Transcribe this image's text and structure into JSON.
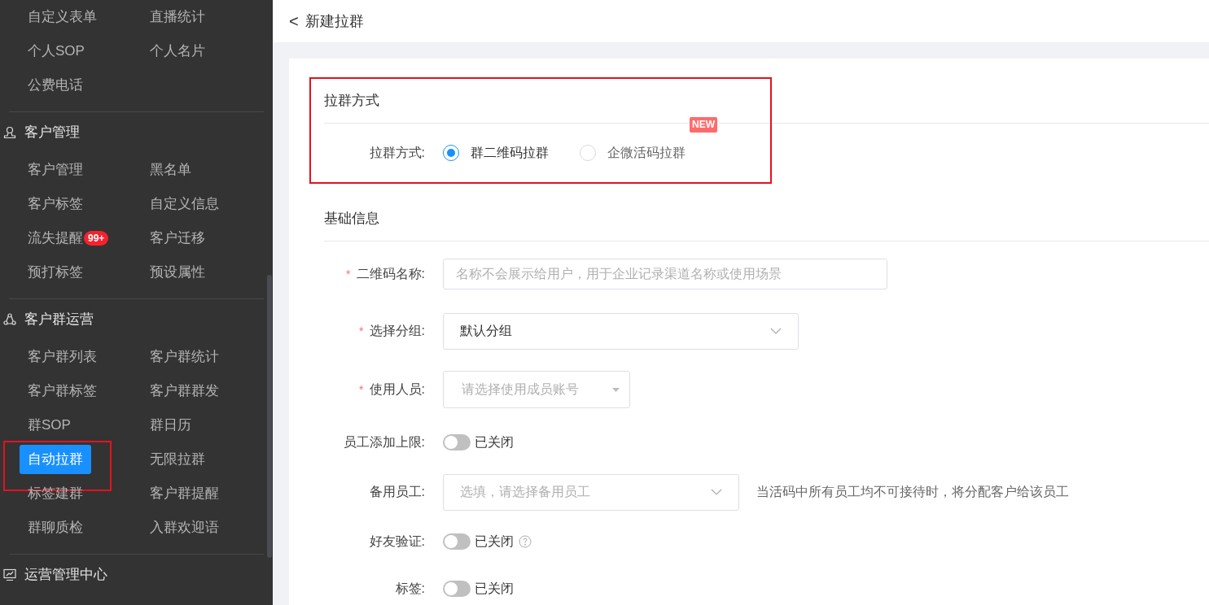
{
  "sidebar": {
    "groups": [
      {
        "items": [
          {
            "label": "自定义表单",
            "selected": false
          },
          {
            "label": "直播统计",
            "selected": false
          },
          {
            "label": "个人SOP",
            "selected": false
          },
          {
            "label": "个人名片",
            "selected": false
          },
          {
            "label": "公费电话",
            "selected": false
          }
        ]
      },
      {
        "title": "客户管理",
        "items": [
          {
            "label": "客户管理",
            "selected": false
          },
          {
            "label": "黑名单",
            "selected": false
          },
          {
            "label": "客户标签",
            "selected": false
          },
          {
            "label": "自定义信息",
            "selected": false
          },
          {
            "label": "流失提醒",
            "selected": false,
            "badge": "99+"
          },
          {
            "label": "客户迁移",
            "selected": false
          },
          {
            "label": "预打标签",
            "selected": false
          },
          {
            "label": "预设属性",
            "selected": false
          }
        ]
      },
      {
        "title": "客户群运营",
        "items": [
          {
            "label": "客户群列表",
            "selected": false
          },
          {
            "label": "客户群统计",
            "selected": false
          },
          {
            "label": "客户群标签",
            "selected": false
          },
          {
            "label": "客户群群发",
            "selected": false
          },
          {
            "label": "群SOP",
            "selected": false
          },
          {
            "label": "群日历",
            "selected": false
          },
          {
            "label": "自动拉群",
            "selected": true,
            "annotated": true
          },
          {
            "label": "无限拉群",
            "selected": false
          },
          {
            "label": "标签建群",
            "selected": false
          },
          {
            "label": "客户群提醒",
            "selected": false
          },
          {
            "label": "群聊质检",
            "selected": false
          },
          {
            "label": "入群欢迎语",
            "selected": false
          }
        ]
      },
      {
        "title": "运营管理中心"
      }
    ]
  },
  "header": {
    "back": "<",
    "title": "新建拉群"
  },
  "sections": [
    {
      "title": "拉群方式",
      "annotated": true,
      "fields": [
        {
          "kind": "radio",
          "label": "拉群方式:",
          "options": [
            {
              "label": "群二维码拉群",
              "selected": true
            },
            {
              "label": "企微活码拉群",
              "selected": false,
              "badge": "NEW"
            }
          ]
        }
      ]
    },
    {
      "title": "基础信息",
      "fields": [
        {
          "kind": "input",
          "label": "二维码名称:",
          "required_mark": "*",
          "placeholder": "名称不会展示给用户，用于企业记录渠道名称或使用场景"
        },
        {
          "kind": "select",
          "label": "选择分组:",
          "required_mark": "*",
          "value": "默认分组"
        },
        {
          "kind": "picker",
          "label": "使用人员:",
          "required_mark": "*",
          "placeholder": "请选择使用成员账号"
        },
        {
          "kind": "switch",
          "label": "员工添加上限:",
          "on": false,
          "status": "已关闭"
        },
        {
          "kind": "select",
          "label": "备用员工:",
          "placeholder": "选填，请选择备用员工",
          "hint": "当活码中所有员工均不可接待时，将分配客户给该员工"
        },
        {
          "kind": "switch",
          "label": "好友验证:",
          "on": false,
          "status": "已关闭",
          "help": true
        },
        {
          "kind": "switch",
          "label": "标签:",
          "on": false,
          "status": "已关闭"
        }
      ]
    }
  ]
}
